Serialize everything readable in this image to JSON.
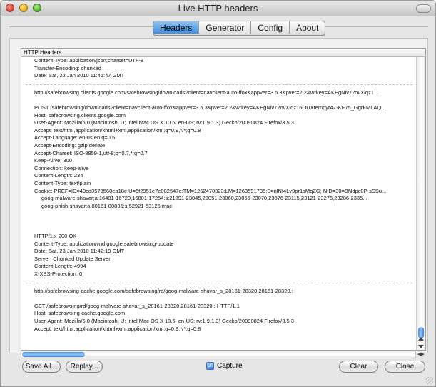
{
  "window": {
    "title": "Live HTTP headers"
  },
  "tabs": [
    {
      "label": "Headers",
      "active": true
    },
    {
      "label": "Generator",
      "active": false
    },
    {
      "label": "Config",
      "active": false
    },
    {
      "label": "About",
      "active": false
    }
  ],
  "list": {
    "header": "HTTP Headers",
    "lines": [
      {
        "type": "text",
        "text": "Content-Type: application/json;charset=UTF-8"
      },
      {
        "type": "text",
        "text": "Transfer-Encoding: chunked"
      },
      {
        "type": "text",
        "text": "Date: Sat, 23 Jan 2010 11:41:47 GMT"
      },
      {
        "type": "sep"
      },
      {
        "type": "text",
        "text": "http://safebrowsing.clients.google.com/safebrowsing/downloads?client=navclient-auto-ffox&appver=3.5.3&pver=2.2&wrkey=AKEgNiv72ovXiqz1..."
      },
      {
        "type": "gap"
      },
      {
        "type": "text",
        "text": "POST /safebrowsing/downloads?client=navclient-auto-ffox&appver=3.5.3&pver=2.2&wrkey=AKEgNiv72ovXiqz16OUXtempyr4Z-KF75_GgrFMLAQ..."
      },
      {
        "type": "text",
        "text": "Host: safebrowsing.clients.google.com"
      },
      {
        "type": "text",
        "text": "User-Agent: Mozilla/5.0 (Macintosh; U; Intel Mac OS X 10.6; en-US; rv:1.9.1.3) Gecko/20090824 Firefox/3.5.3"
      },
      {
        "type": "text",
        "text": "Accept: text/html,application/xhtml+xml,application/xml;q=0.9,*/*;q=0.8"
      },
      {
        "type": "text",
        "text": "Accept-Language: en-us,en;q=0.5"
      },
      {
        "type": "text",
        "text": "Accept-Encoding: gzip,deflate"
      },
      {
        "type": "text",
        "text": "Accept-Charset: ISO-8859-1,utf-8;q=0.7,*;q=0.7"
      },
      {
        "type": "text",
        "text": "Keep-Alive: 300"
      },
      {
        "type": "text",
        "text": "Connection: keep-alive"
      },
      {
        "type": "text",
        "text": "Content-Length: 234"
      },
      {
        "type": "text",
        "text": "Content-Type: text/plain"
      },
      {
        "type": "text",
        "text": "Cookie: PREF=ID=40cd3573560ea18e:U=5f2951e7e082547e:TM=1262470323:LM=1263591735:S=nlNf4Lv9pr1sMqZG; NID=30=BNdpc0P-sSSu..."
      },
      {
        "type": "indent",
        "text": "goog-malware-shavar;a:16481-16720,16801-17254:s:21891-23045,23051-23060,23066-23070,23076-23115,23121-23275,23286-2335..."
      },
      {
        "type": "indent",
        "text": "goog-phish-shavar;a:80161-80835:s:52921-53125:mac"
      },
      {
        "type": "gap"
      },
      {
        "type": "gap"
      },
      {
        "type": "gap"
      },
      {
        "type": "text",
        "text": "HTTP/1.x 200 OK"
      },
      {
        "type": "text",
        "text": "Content-Type: application/vnd.google.safebrowsing-update"
      },
      {
        "type": "text",
        "text": "Date: Sat, 23 Jan 2010 11:42:19 GMT"
      },
      {
        "type": "text",
        "text": "Server: Chunked Update Server"
      },
      {
        "type": "text",
        "text": "Content-Length: 4994"
      },
      {
        "type": "text",
        "text": "X-XSS-Protection: 0"
      },
      {
        "type": "sep"
      },
      {
        "type": "text",
        "text": "http://safebrowsing-cache.google.com/safebrowsing/rd/goog-malware-shavar_s_28161-28320.28161-28320.:"
      },
      {
        "type": "gap"
      },
      {
        "type": "text",
        "text": "GET /safebrowsing/rd/goog-malware-shavar_s_28161-28320.28161-28320.: HTTP/1.1"
      },
      {
        "type": "text",
        "text": "Host: safebrowsing-cache.google.com"
      },
      {
        "type": "text",
        "text": "User-Agent: Mozilla/5.0 (Macintosh; U; Intel Mac OS X 10.6; en-US; rv:1.9.1.3) Gecko/20090824 Firefox/3.5.3"
      },
      {
        "type": "text",
        "text": "Accept: text/html,application/xhtml+xml,application/xml;q=0.9,*/*;q=0.8"
      }
    ]
  },
  "buttons": {
    "save_all": "Save All...",
    "replay": "Replay...",
    "clear": "Clear",
    "close": "Close"
  },
  "capture": {
    "label": "Capture",
    "checked": true,
    "check_glyph": "✓"
  },
  "icons": [
    "close-icon",
    "minimize-icon",
    "zoom-icon",
    "toolbar-toggle-icon",
    "scroll-up-icon",
    "scroll-down-icon",
    "scroll-left-icon",
    "scroll-right-icon",
    "resize-grip-icon"
  ],
  "colors": {
    "accent": "#3f8fe0",
    "window_bg": "#e6e6e6"
  }
}
